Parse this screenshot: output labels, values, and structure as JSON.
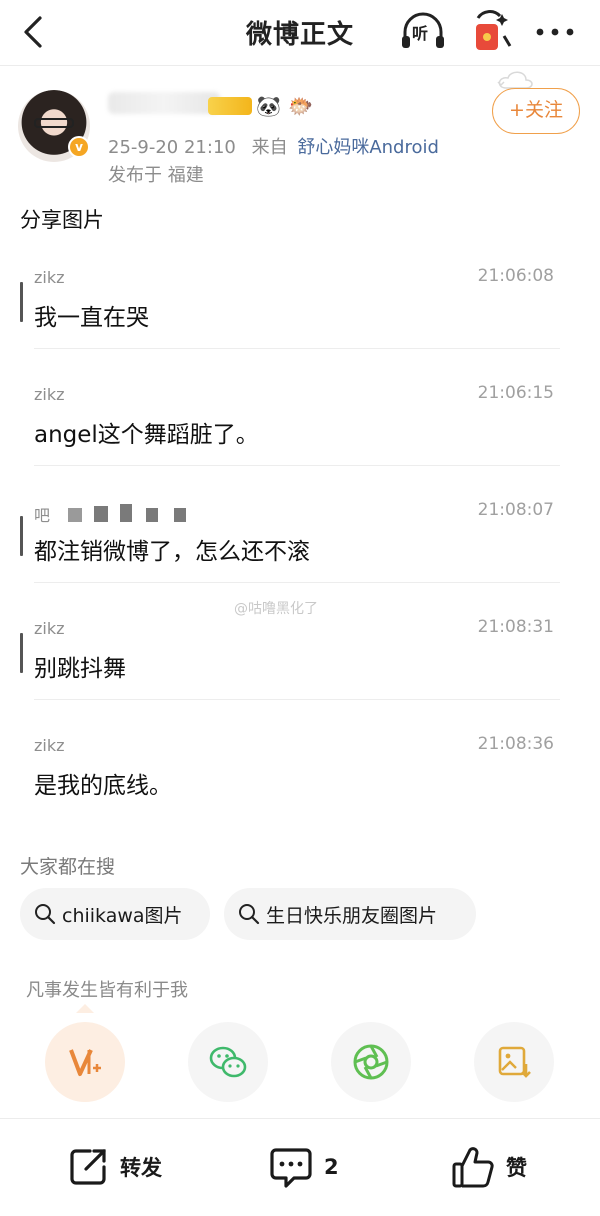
{
  "header": {
    "title": "微博正文",
    "listen_label": "听",
    "back_icon": "chevron-left-icon",
    "redpacket_icon": "red-packet-icon",
    "more_icon": "more-dots-icon"
  },
  "post": {
    "time": "25-9-20 21:10",
    "source_prefix": "来自",
    "source": "舒心妈咪Android",
    "location": "发布于 福建",
    "follow_label": "+关注",
    "text": "分享图片",
    "badges": [
      "vip-badge",
      "panda-icon",
      "fish-icon"
    ]
  },
  "chat": {
    "messages": [
      {
        "name": "zikz",
        "time": "21:06:08",
        "text": "我一直在哭"
      },
      {
        "name": "zikz",
        "time": "21:06:15",
        "text": "angel这个舞蹈脏了。"
      },
      {
        "name": "吧",
        "time": "21:08:07",
        "text": "都注销微博了，怎么还不滚"
      },
      {
        "name": "zikz",
        "time": "21:08:31",
        "text": "别跳抖舞"
      },
      {
        "name": "zikz",
        "time": "21:08:36",
        "text": "是我的底线。"
      }
    ],
    "watermark": "@咕噜黑化了"
  },
  "search": {
    "title": "大家都在搜",
    "chips": [
      "chiikawa图片",
      "生日快乐朋友圈图片"
    ]
  },
  "motto": "凡事发生皆有利于我",
  "share": {
    "items": [
      "vplus-icon",
      "wechat-icon",
      "moments-icon",
      "save-image-icon"
    ]
  },
  "actions": {
    "repost_label": "转发",
    "comment_count": "2",
    "like_label": "赞"
  },
  "colors": {
    "accent_orange": "#e8873a",
    "link_blue": "#4a6a9c",
    "wechat_green": "#3fb96b",
    "save_yellow": "#e0a93a"
  }
}
